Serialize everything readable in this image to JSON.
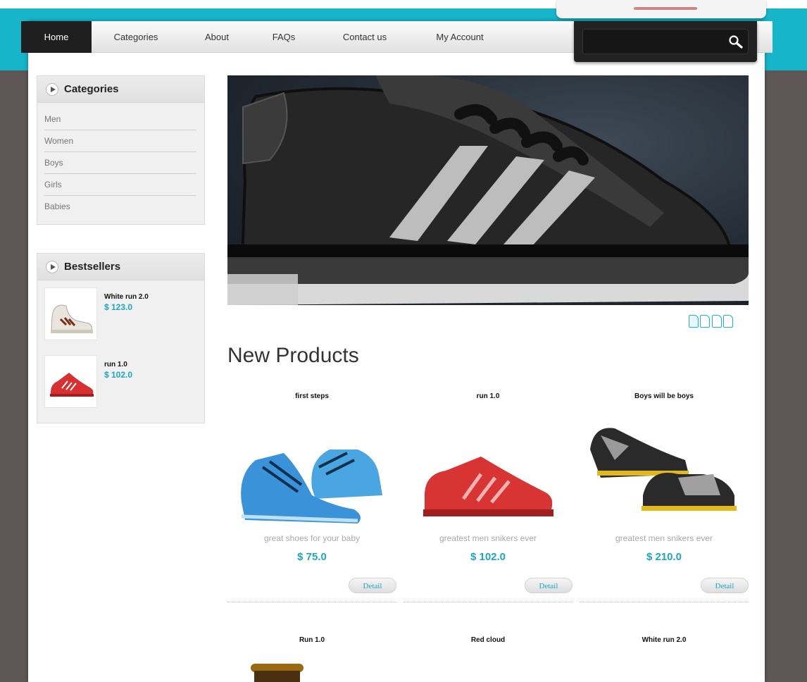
{
  "nav": {
    "items": [
      {
        "label": "Home",
        "active": true
      },
      {
        "label": "Categories",
        "active": false
      },
      {
        "label": "About",
        "active": false
      },
      {
        "label": "FAQs",
        "active": false
      },
      {
        "label": "Contact us",
        "active": false
      },
      {
        "label": "My Account",
        "active": false
      }
    ],
    "search_value": "",
    "search_icon": "search-icon"
  },
  "sidebar": {
    "categories": {
      "title": "Categories",
      "items": [
        "Men",
        "Women",
        "Boys",
        "Girls",
        "Babies"
      ]
    },
    "bestsellers": {
      "title": "Bestsellers",
      "items": [
        {
          "name": "White run 2.0",
          "price": "$ 123.0"
        },
        {
          "name": "run 1.0",
          "price": "$ 102.0"
        }
      ]
    }
  },
  "banner": {
    "slides_total": 4,
    "active_slide": 1
  },
  "new_products": {
    "title": "New Products",
    "row1": [
      {
        "name": "first steps",
        "description": "great shoes for your baby",
        "price": "$ 75.0",
        "button": "Detail"
      },
      {
        "name": "run 1.0",
        "description": "greatest men snikers ever",
        "price": "$ 102.0",
        "button": "Detail"
      },
      {
        "name": "Boys will be boys",
        "description": "greatest men snikers ever",
        "price": "$ 210.0",
        "button": "Detail"
      }
    ],
    "row2": [
      {
        "name": "Run 1.0"
      },
      {
        "name": "Red cloud"
      },
      {
        "name": "White run 2.0"
      }
    ]
  },
  "colors": {
    "teal": "#17b5c9",
    "price": "#1aa8c4",
    "background": "#5f5756"
  }
}
